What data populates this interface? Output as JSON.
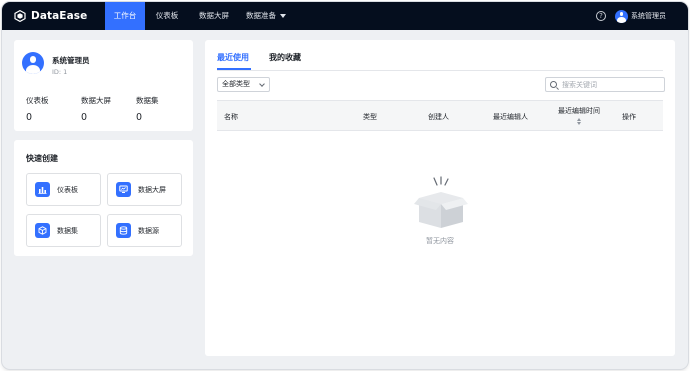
{
  "app": {
    "logo_text": "DataEase",
    "nav": [
      {
        "label": "工作台",
        "active": true
      },
      {
        "label": "仪表板",
        "active": false
      },
      {
        "label": "数据大屏",
        "active": false
      },
      {
        "label": "数据准备",
        "active": false,
        "has_dropdown": true
      }
    ],
    "user_name": "系统管理员",
    "accent_color": "#3370ff",
    "topbar_color": "#050e1e"
  },
  "profile": {
    "name": "系统管理员",
    "id_text": "ID: 1",
    "stats": [
      {
        "label": "仪表板",
        "value": "0"
      },
      {
        "label": "数据大屏",
        "value": "0"
      },
      {
        "label": "数据集",
        "value": "0"
      }
    ]
  },
  "quick_create": {
    "title": "快速创建",
    "items": [
      {
        "label": "仪表板",
        "icon": "dashboard-chart-icon"
      },
      {
        "label": "数据大屏",
        "icon": "screen-icon"
      },
      {
        "label": "数据集",
        "icon": "cube-icon"
      },
      {
        "label": "数据源",
        "icon": "database-icon"
      }
    ]
  },
  "main": {
    "tabs": [
      {
        "label": "最近使用",
        "active": true
      },
      {
        "label": "我的收藏",
        "active": false
      }
    ],
    "type_filter": "全部类型",
    "search_placeholder": "搜索关键词",
    "columns": [
      "名称",
      "类型",
      "创建人",
      "最近编辑人",
      "最近编辑时间",
      "操作"
    ],
    "empty_text": "暂无内容"
  }
}
